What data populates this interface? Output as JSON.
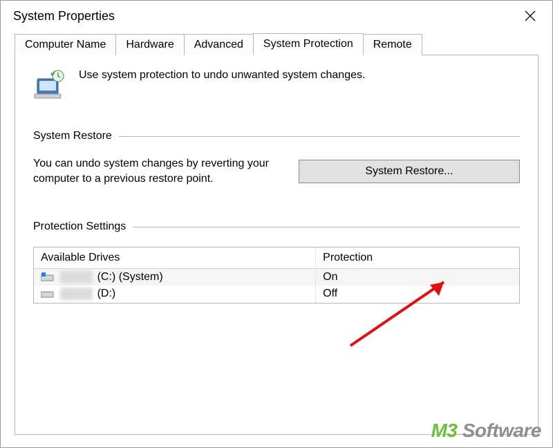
{
  "window": {
    "title": "System Properties"
  },
  "tabs": [
    {
      "label": "Computer Name",
      "active": false
    },
    {
      "label": "Hardware",
      "active": false
    },
    {
      "label": "Advanced",
      "active": false
    },
    {
      "label": "System Protection",
      "active": true
    },
    {
      "label": "Remote",
      "active": false
    }
  ],
  "intro": {
    "text": "Use system protection to undo unwanted system changes."
  },
  "system_restore": {
    "group_label": "System Restore",
    "desc": "You can undo system changes by reverting your computer to a previous restore point.",
    "button": "System Restore..."
  },
  "protection_settings": {
    "group_label": "Protection Settings",
    "columns": {
      "drive": "Available Drives",
      "protection": "Protection"
    },
    "rows": [
      {
        "drive_suffix": "(C:) (System)",
        "protection": "On"
      },
      {
        "drive_suffix": "(D:)",
        "protection": "Off"
      }
    ]
  },
  "watermark": {
    "brand": "M3",
    "rest": " Software"
  }
}
